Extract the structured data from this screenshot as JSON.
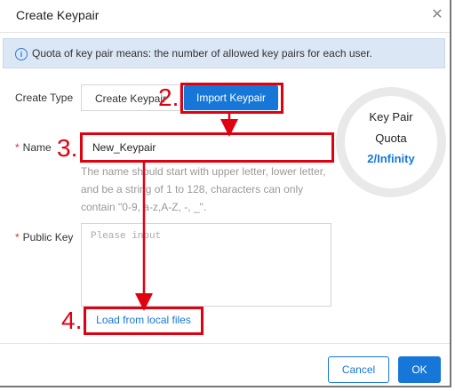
{
  "dialog": {
    "title": "Create Keypair",
    "close_icon": "close-icon"
  },
  "notice": {
    "icon": "info-icon",
    "text": "Quota of key pair means: the number of allowed key pairs for each user."
  },
  "form": {
    "create_type_label": "Create Type",
    "create_type_options": [
      "Create Keypair",
      "Import Keypair"
    ],
    "selected_type": "Import Keypair",
    "name_label": "Name",
    "name_required_mark": "*",
    "name_value": "New_Keypair",
    "name_hint_lines": [
      "The name should start with upper letter, lower letter,",
      "and be a string of 1 to 128, characters can only",
      "contain \"0-9, a-z,A-Z, -, _\"."
    ],
    "public_key_label": "Public Key",
    "public_key_required_mark": "*",
    "public_key_placeholder": "Please input",
    "load_button": "Load from local files"
  },
  "quota": {
    "line1": "Key Pair",
    "line2": "Quota",
    "value": "2/Infinity"
  },
  "annotations": {
    "step2": "2.",
    "step3": "3.",
    "step4": "4.",
    "color": "#e00010"
  },
  "footer": {
    "cancel_label": "Cancel",
    "ok_label": "OK"
  },
  "colors": {
    "primary": "#1677d8",
    "notice_bg": "#dbe7f5",
    "required": "#e52b2b"
  }
}
